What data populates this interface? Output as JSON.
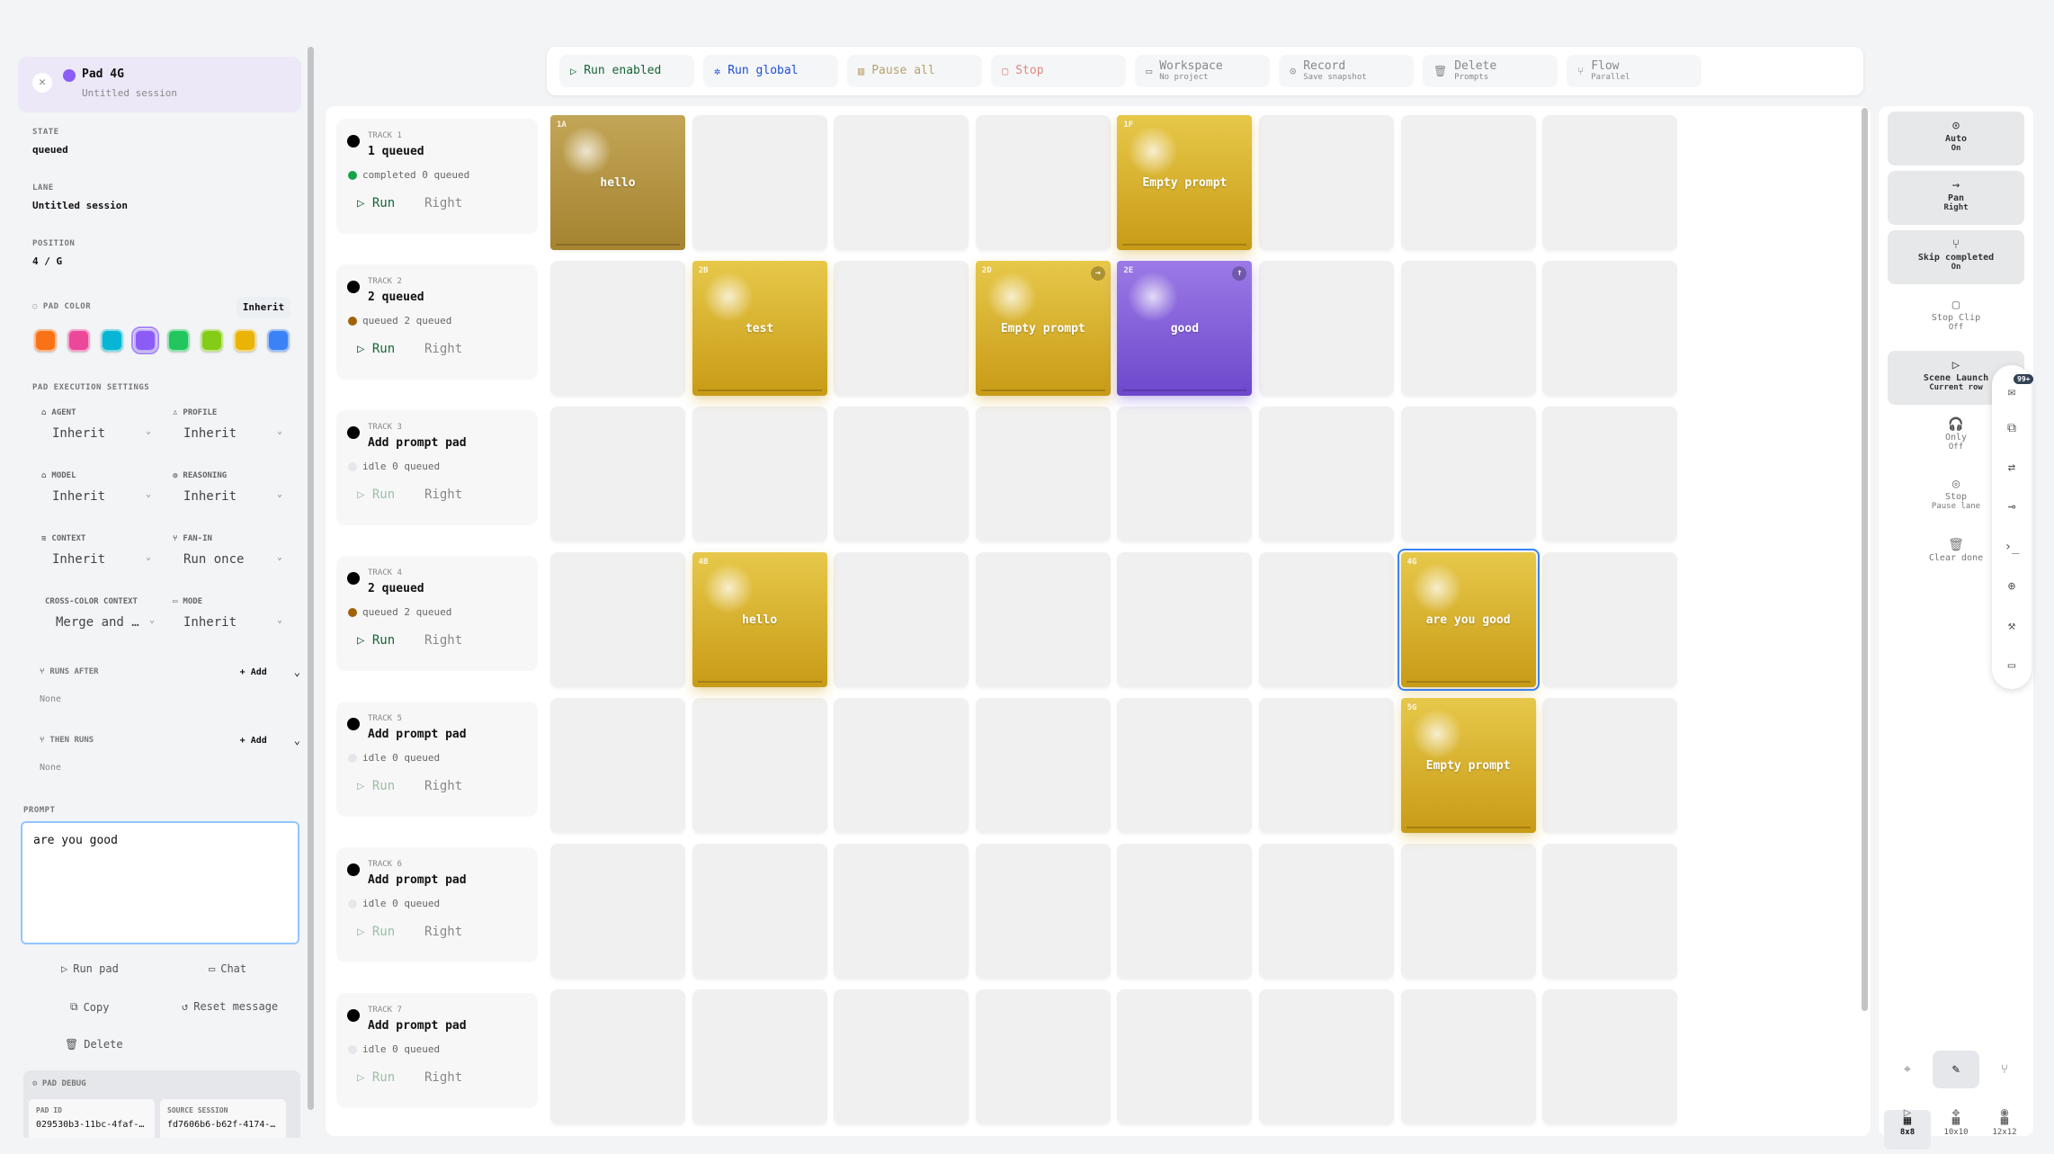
{
  "header": {
    "title": "Pad 4G",
    "subtitle": "Untitled session"
  },
  "left": {
    "state_label": "STATE",
    "state": "queued",
    "lane_label": "LANE",
    "lane": "Untitled session",
    "position_label": "POSITION",
    "position": "4 / G",
    "pad_color_label": "PAD COLOR",
    "inherit_button": "Inherit",
    "swatches": [
      "#f97316",
      "#ec4899",
      "#06b6d4",
      "#8b5cf6",
      "#22c55e",
      "#84cc16",
      "#eab308",
      "#3b82f6"
    ],
    "exec_label": "PAD EXECUTION SETTINGS",
    "fields": {
      "agent": {
        "label": "AGENT",
        "value": "Inherit"
      },
      "profile": {
        "label": "PROFILE",
        "value": "Inherit"
      },
      "model": {
        "label": "MODEL",
        "value": "Inherit"
      },
      "reasoning": {
        "label": "REASONING",
        "value": "Inherit"
      },
      "context": {
        "label": "CONTEXT",
        "value": "Inherit"
      },
      "fanin": {
        "label": "FAN-IN",
        "value": "Run once"
      },
      "cross": {
        "label": "CROSS-COLOR CONTEXT",
        "value": "Merge and …"
      },
      "mode": {
        "label": "MODE",
        "value": "Inherit"
      }
    },
    "runs_after": {
      "label": "RUNS AFTER",
      "add": "+ Add",
      "none": "None"
    },
    "then_runs": {
      "label": "THEN RUNS",
      "add": "+ Add",
      "none": "None"
    },
    "prompt_label": "PROMPT",
    "prompt": "are you good",
    "actions": {
      "run_pad": "Run pad",
      "chat": "Chat",
      "copy": "Copy",
      "reset": "Reset message",
      "delete": "Delete"
    },
    "debug": {
      "label": "PAD DEBUG",
      "pad_id_label": "PAD ID",
      "pad_id": "029530b3-11bc-4faf-…",
      "source_label": "SOURCE SESSION",
      "source": "fd7606b6-b62f-4174-…"
    }
  },
  "toolbar": [
    {
      "title": "Run enabled",
      "sub": "",
      "icon": "▷",
      "color": "#166534"
    },
    {
      "title": "Run global",
      "sub": "",
      "icon": "✲",
      "color": "#1d4ed8"
    },
    {
      "title": "Pause all",
      "sub": "",
      "icon": "▥",
      "color": "#b7a16a"
    },
    {
      "title": "Stop",
      "sub": "",
      "icon": "▢",
      "color": "#e0877f"
    },
    {
      "title": "Workspace",
      "sub": "No project",
      "icon": "▭",
      "color": "#888"
    },
    {
      "title": "Record",
      "sub": "Save snapshot",
      "icon": "⊙",
      "color": "#888"
    },
    {
      "title": "Delete",
      "sub": "Prompts",
      "icon": "🗑",
      "color": "#888"
    },
    {
      "title": "Flow",
      "sub": "Parallel",
      "icon": "⑂",
      "color": "#888"
    }
  ],
  "tracks": [
    {
      "label": "TRACK 1",
      "name": "1 queued",
      "status": "completed 0 queued",
      "status_color": "#16a34a",
      "run": "Run",
      "right": "Right"
    },
    {
      "label": "TRACK 2",
      "name": "2 queued",
      "status": "queued 2 queued",
      "status_color": "#a16207",
      "run": "Run",
      "right": "Right"
    },
    {
      "label": "TRACK 3",
      "name": "Add prompt pad",
      "status": "idle 0 queued",
      "status_color": "#e5e7eb",
      "run": "Run",
      "right": "Right"
    },
    {
      "label": "TRACK 4",
      "name": "2 queued",
      "status": "queued 2 queued",
      "status_color": "#a16207",
      "run": "Run",
      "right": "Right"
    },
    {
      "label": "TRACK 5",
      "name": "Add prompt pad",
      "status": "idle 0 queued",
      "status_color": "#e5e7eb",
      "run": "Run",
      "right": "Right"
    },
    {
      "label": "TRACK 6",
      "name": "Add prompt pad",
      "status": "idle 0 queued",
      "status_color": "#e5e7eb",
      "run": "Run",
      "right": "Right"
    },
    {
      "label": "TRACK 7",
      "name": "Add prompt pad",
      "status": "idle 0 queued",
      "status_color": "#e5e7eb",
      "run": "Run",
      "right": "Right"
    }
  ],
  "pads": [
    {
      "code": "1A",
      "text": "hello",
      "row": 0,
      "col": 0,
      "style": "dimgold",
      "badge": ""
    },
    {
      "code": "1F",
      "text": "Empty prompt",
      "row": 0,
      "col": 4,
      "style": "gold",
      "badge": ""
    },
    {
      "code": "2B",
      "text": "test",
      "row": 1,
      "col": 1,
      "style": "gold",
      "badge": ""
    },
    {
      "code": "2D",
      "text": "Empty prompt",
      "row": 1,
      "col": 3,
      "style": "gold",
      "badge": "→"
    },
    {
      "code": "2E",
      "text": "good",
      "row": 1,
      "col": 4,
      "style": "purple",
      "badge": "↑"
    },
    {
      "code": "4B",
      "text": "hello",
      "row": 3,
      "col": 1,
      "style": "gold",
      "badge": ""
    },
    {
      "code": "4G",
      "text": "are you good",
      "row": 3,
      "col": 6,
      "style": "gold selected",
      "badge": ""
    },
    {
      "code": "5G",
      "text": "Empty prompt",
      "row": 4,
      "col": 6,
      "style": "gold",
      "badge": ""
    }
  ],
  "right": [
    {
      "icon": "⊙",
      "title": "Auto",
      "sub": "On",
      "on": true
    },
    {
      "icon": "→",
      "title": "Pan",
      "sub": "Right",
      "on": true
    },
    {
      "icon": "⑂",
      "title": "Skip completed",
      "sub": "On",
      "on": true
    },
    {
      "icon": "▢",
      "title": "Stop Clip",
      "sub": "Off",
      "on": false
    },
    {
      "icon": "▷",
      "title": "Scene Launch",
      "sub": "Current row",
      "on": true
    },
    {
      "icon": "🎧",
      "title": "Only",
      "sub": "Off",
      "on": false
    },
    {
      "icon": "◎",
      "title": "Stop",
      "sub": "Pause lane",
      "on": false
    },
    {
      "icon": "🗑",
      "title": "Clear done",
      "sub": "",
      "on": false
    }
  ],
  "notif": "99+",
  "grid_sizes": [
    "8x8",
    "10x10",
    "12x12"
  ]
}
